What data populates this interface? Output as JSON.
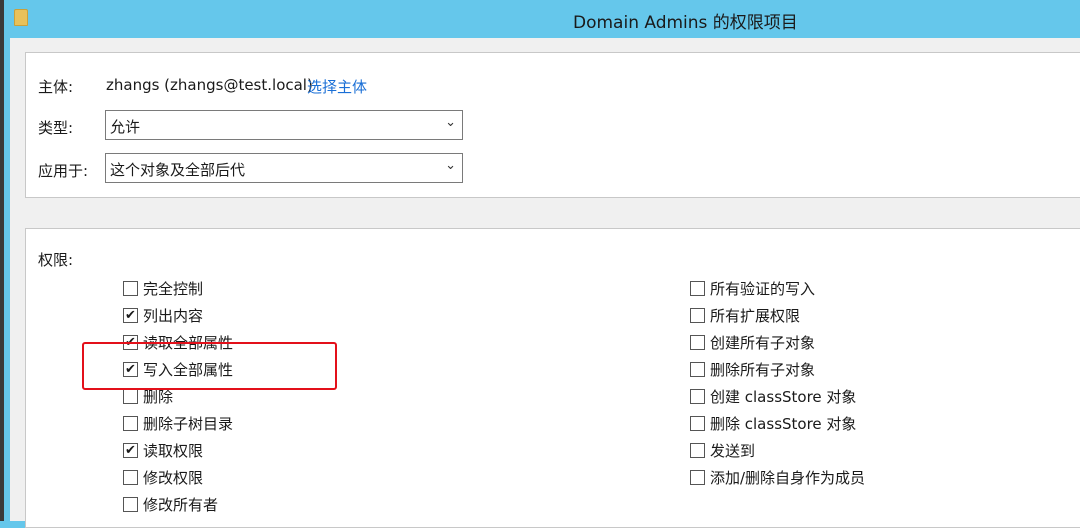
{
  "window": {
    "title": "Domain Admins 的权限项目"
  },
  "principal": {
    "label": "主体:",
    "value": "zhangs (zhangs@test.local)",
    "select_link": "选择主体"
  },
  "type": {
    "label": "类型:",
    "value": "允许"
  },
  "applies_to": {
    "label": "应用于:",
    "value": "这个对象及全部后代"
  },
  "permissions": {
    "label": "权限:",
    "left": [
      {
        "label": "完全控制",
        "checked": false
      },
      {
        "label": "列出内容",
        "checked": true
      },
      {
        "label": "读取全部属性",
        "checked": true
      },
      {
        "label": "写入全部属性",
        "checked": true
      },
      {
        "label": "删除",
        "checked": false
      },
      {
        "label": "删除子树目录",
        "checked": false
      },
      {
        "label": "读取权限",
        "checked": true
      },
      {
        "label": "修改权限",
        "checked": false
      },
      {
        "label": "修改所有者",
        "checked": false
      }
    ],
    "right": [
      {
        "label": "所有验证的写入",
        "checked": false
      },
      {
        "label": "所有扩展权限",
        "checked": false
      },
      {
        "label": "创建所有子对象",
        "checked": false
      },
      {
        "label": "删除所有子对象",
        "checked": false
      },
      {
        "label": "创建 classStore 对象",
        "checked": false
      },
      {
        "label": "删除 classStore 对象",
        "checked": false
      },
      {
        "label": "发送到",
        "checked": false
      },
      {
        "label": "添加/删除自身作为成员",
        "checked": false
      }
    ]
  },
  "highlight_color": "#e3101a"
}
